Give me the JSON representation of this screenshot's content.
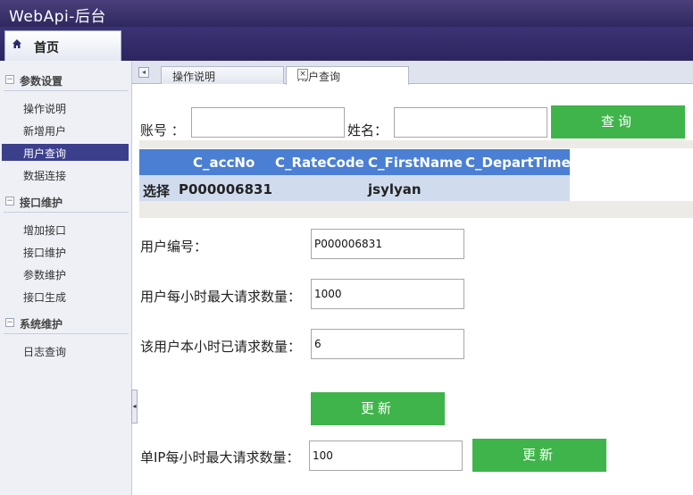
{
  "app": {
    "title": "WebApi-后台"
  },
  "navbar": {
    "home_label": "首页"
  },
  "sidebar": {
    "groups": [
      {
        "label": "参数设置",
        "items": [
          "操作说明",
          "新增用户",
          "用户查询",
          "数据连接"
        ]
      },
      {
        "label": "接口维护",
        "items": [
          "增加接口",
          "接口维护",
          "参数维护",
          "接口生成"
        ]
      },
      {
        "label": "系统维护",
        "items": [
          "日志查询"
        ]
      }
    ],
    "active_item": "用户查询",
    "toggle_symbol": "−"
  },
  "tabs": {
    "items": [
      {
        "label": "操作说明",
        "active": false
      },
      {
        "label": "用户查询",
        "active": true
      }
    ],
    "close_symbol": "×"
  },
  "search": {
    "account_label": "账号 ：",
    "account_value": "",
    "name_label": "姓名：",
    "name_value": "",
    "query_button": "查询"
  },
  "grid": {
    "columns": [
      "C_accNo",
      "C_RateCode",
      "C_FirstName",
      "C_DepartTime"
    ],
    "rows": [
      {
        "select": "选择",
        "C_accNo": "P000006831",
        "C_RateCode": "",
        "C_FirstName": "jsylyan",
        "C_DepartTime": ""
      }
    ]
  },
  "detail": {
    "user_id_label": "用户编号：",
    "user_id_value": "P000006831",
    "max_per_hour_label": "用户每小时最大请求数量：",
    "max_per_hour_value": "1000",
    "used_this_hour_label": "该用户本小时已请求数量：",
    "used_this_hour_value": "6",
    "update_button": "更新",
    "ip_max_label": "单IP每小时最大请求数量：",
    "ip_max_value": "100",
    "ip_update_button": "更新"
  },
  "colors": {
    "header_bg": "#2f2860",
    "accent_green": "#3fb44a",
    "grid_header": "#4a7fd4",
    "grid_row": "#d0dcee",
    "sidebar_active": "#3b3f8c"
  },
  "icons": [
    "home-icon",
    "tab-scroll-left-icon",
    "close-icon",
    "collapse-arrow-icon"
  ]
}
